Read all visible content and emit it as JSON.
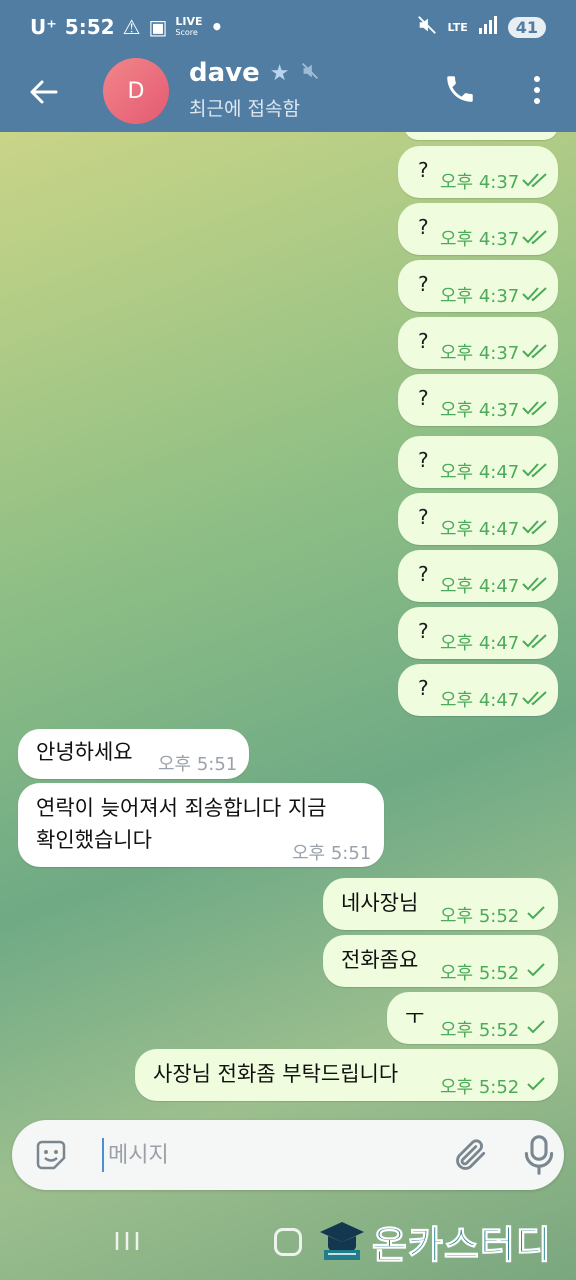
{
  "status_bar": {
    "carrier": "U⁺",
    "time": "5:52",
    "live_top": "LIVE",
    "live_bottom": "Score",
    "network": "LTE",
    "battery": "41"
  },
  "header": {
    "avatar_letter": "D",
    "name": "dave",
    "status": "최근에 접속함"
  },
  "messages": [
    {
      "dir": "out",
      "text": "?",
      "time": "오후 4:37",
      "read": true
    },
    {
      "dir": "out",
      "text": "?",
      "time": "오후 4:37",
      "read": true
    },
    {
      "dir": "out",
      "text": "?",
      "time": "오후 4:37",
      "read": true
    },
    {
      "dir": "out",
      "text": "?",
      "time": "오후 4:37",
      "read": true
    },
    {
      "dir": "out",
      "text": "?",
      "time": "오후 4:37",
      "read": true
    },
    {
      "dir": "out",
      "text": "?",
      "time": "오후 4:47",
      "read": true
    },
    {
      "dir": "out",
      "text": "?",
      "time": "오후 4:47",
      "read": true
    },
    {
      "dir": "out",
      "text": "?",
      "time": "오후 4:47",
      "read": true
    },
    {
      "dir": "out",
      "text": "?",
      "time": "오후 4:47",
      "read": true
    },
    {
      "dir": "out",
      "text": "?",
      "time": "오후 4:47",
      "read": true
    },
    {
      "dir": "in",
      "text": "안녕하세요",
      "time": "오후 5:51"
    },
    {
      "dir": "in",
      "text_line1": "연락이 늦어져서 죄송합니다 지금",
      "text_line2": "확인했습니다",
      "time": "오후 5:51"
    },
    {
      "dir": "out",
      "text": "네사장님",
      "time": "오후 5:52",
      "read": false
    },
    {
      "dir": "out",
      "text": "전화좀요",
      "time": "오후 5:52",
      "read": false
    },
    {
      "dir": "out",
      "text": "ㅜ",
      "time": "오후 5:52",
      "read": false
    },
    {
      "dir": "out",
      "text": "사장님 전화좀 부탁드립니다",
      "time": "오후 5:52",
      "read": false
    }
  ],
  "composer": {
    "placeholder": "메시지"
  },
  "watermark": "온카스터디",
  "colors": {
    "header": "#517da2",
    "out_bubble": "#effdde",
    "in_bubble": "#ffffff",
    "check": "#4caa5a"
  }
}
